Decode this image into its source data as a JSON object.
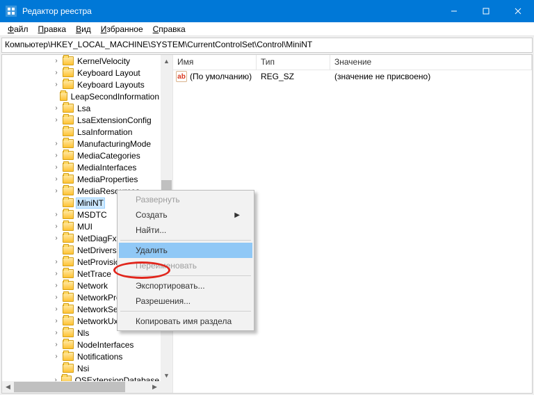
{
  "title": "Редактор реестра",
  "menu": {
    "file": "Файл",
    "edit": "Правка",
    "view": "Вид",
    "favorites": "Избранное",
    "help": "Справка"
  },
  "address": "Компьютер\\HKEY_LOCAL_MACHINE\\SYSTEM\\CurrentControlSet\\Control\\MiniNT",
  "tree": [
    {
      "label": "KernelVelocity",
      "expandable": true
    },
    {
      "label": "Keyboard Layout",
      "expandable": true
    },
    {
      "label": "Keyboard Layouts",
      "expandable": true
    },
    {
      "label": "LeapSecondInformation",
      "expandable": false
    },
    {
      "label": "Lsa",
      "expandable": true
    },
    {
      "label": "LsaExtensionConfig",
      "expandable": true
    },
    {
      "label": "LsaInformation",
      "expandable": false
    },
    {
      "label": "ManufacturingMode",
      "expandable": true
    },
    {
      "label": "MediaCategories",
      "expandable": true
    },
    {
      "label": "MediaInterfaces",
      "expandable": true
    },
    {
      "label": "MediaProperties",
      "expandable": true
    },
    {
      "label": "MediaResources",
      "expandable": true
    },
    {
      "label": "MiniNT",
      "expandable": false,
      "selected": true
    },
    {
      "label": "MSDTC",
      "expandable": true
    },
    {
      "label": "MUI",
      "expandable": true
    },
    {
      "label": "NetDiagFx",
      "expandable": true
    },
    {
      "label": "NetDrivers",
      "expandable": false
    },
    {
      "label": "NetProvision",
      "expandable": true
    },
    {
      "label": "NetTrace",
      "expandable": true
    },
    {
      "label": "Network",
      "expandable": true
    },
    {
      "label": "NetworkProvider",
      "expandable": true
    },
    {
      "label": "NetworkSetup2",
      "expandable": true
    },
    {
      "label": "NetworkUxManager",
      "expandable": true
    },
    {
      "label": "Nls",
      "expandable": true
    },
    {
      "label": "NodeInterfaces",
      "expandable": true
    },
    {
      "label": "Notifications",
      "expandable": true
    },
    {
      "label": "Nsi",
      "expandable": false
    },
    {
      "label": "OSExtensionDatabase",
      "expandable": true
    }
  ],
  "columns": {
    "name": "Имя",
    "type": "Тип",
    "value": "Значение"
  },
  "rows": [
    {
      "name": "(По умолчанию)",
      "type": "REG_SZ",
      "value": "(значение не присвоено)"
    }
  ],
  "contextMenu": {
    "expand": "Развернуть",
    "new": "Создать",
    "find": "Найти...",
    "delete": "Удалить",
    "rename": "Переименовать",
    "export": "Экспортировать...",
    "permissions": "Разрешения...",
    "copyKeyName": "Копировать имя раздела"
  },
  "iconGlyph": "ab"
}
